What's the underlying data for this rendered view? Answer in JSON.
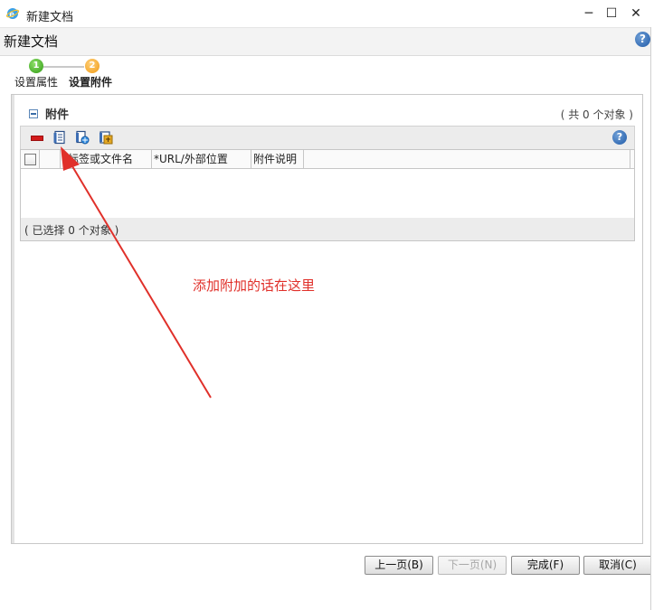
{
  "window": {
    "title": "新建文档",
    "controls": [
      "─",
      "☐",
      "✕"
    ]
  },
  "header": {
    "title": "新建文档",
    "help": "?"
  },
  "steps": [
    {
      "number": "1",
      "label": "设置属性",
      "state": "done",
      "color": "#2f9a13"
    },
    {
      "number": "2",
      "label": "设置附件",
      "state": "current",
      "color": "#f09a12"
    }
  ],
  "attachments": {
    "section_title": "附件",
    "count_text": "( 共 0 个对象 )",
    "toolbar_help": "?",
    "columns": [
      "",
      "*标签或文件名",
      "*URL/外部位置",
      "附件说明"
    ],
    "rows": [],
    "footer_text": "( 已选择 0 个对象 )"
  },
  "annotation": {
    "text": "添加附加的话在这里",
    "color": "#e0302a"
  },
  "buttons": {
    "prev": "上一页(B)",
    "next": "下一页(N)",
    "finish": "完成(F)",
    "cancel": "取消(C)"
  },
  "colors": {
    "accent_red": "#e0302a",
    "help_blue": "#1f5aa8"
  }
}
